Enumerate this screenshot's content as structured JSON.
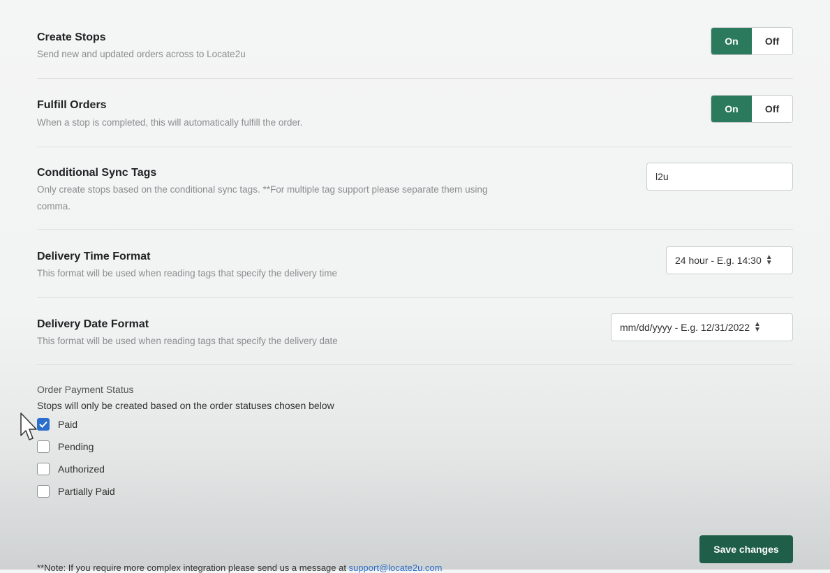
{
  "settings": {
    "create_stops": {
      "title": "Create Stops",
      "description": "Send new and updated orders across to Locate2u",
      "on_label": "On",
      "off_label": "Off",
      "value": "On"
    },
    "fulfill_orders": {
      "title": "Fulfill Orders",
      "description": "When a stop is completed, this will automatically fulfill the order.",
      "on_label": "On",
      "off_label": "Off",
      "value": "On"
    },
    "conditional_sync_tags": {
      "title": "Conditional Sync Tags",
      "description": "Only create stops based on the conditional sync tags. **For multiple tag support please separate them using comma.",
      "value": "l2u"
    },
    "delivery_time_format": {
      "title": "Delivery Time Format",
      "description": "This format will be used when reading tags that specify the delivery time",
      "selected": "24 hour - E.g. 14:30"
    },
    "delivery_date_format": {
      "title": "Delivery Date Format",
      "description": "This format will be used when reading tags that specify the delivery date",
      "selected": "mm/dd/yyyy - E.g. 12/31/2022"
    }
  },
  "order_payment_status": {
    "label": "Order Payment Status",
    "description": "Stops will only be created based on the order statuses chosen below",
    "options": [
      {
        "label": "Paid",
        "checked": true
      },
      {
        "label": "Pending",
        "checked": false
      },
      {
        "label": "Authorized",
        "checked": false
      },
      {
        "label": "Partially Paid",
        "checked": false
      }
    ]
  },
  "save_button_label": "Save changes",
  "footer": {
    "note": "**Note: If you require more complex integration please send us a message at",
    "email": "support@locate2u.com"
  },
  "colors": {
    "toggle_on": "#2b7a5e",
    "save_button": "#1f5e48",
    "checkbox_checked": "#2c6ecb"
  }
}
